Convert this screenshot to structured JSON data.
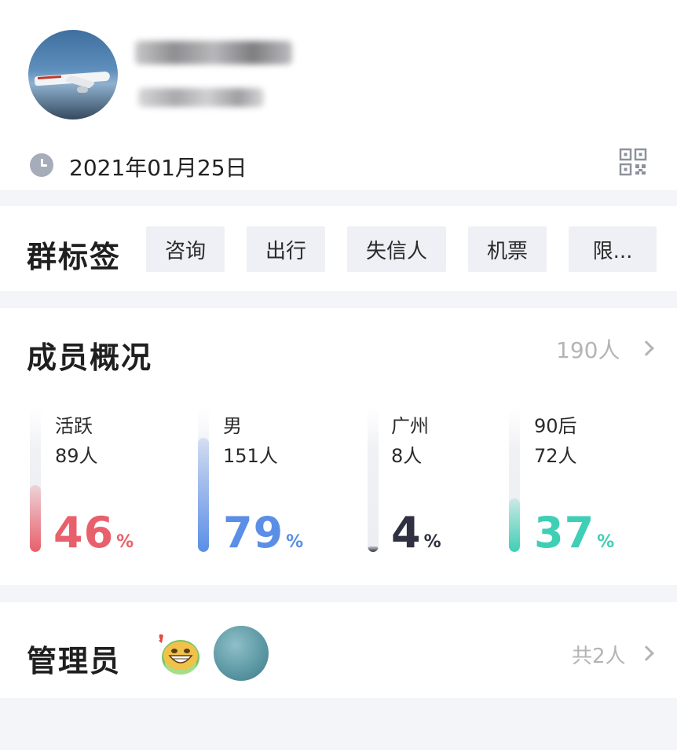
{
  "header": {
    "date": "2021年01月25日",
    "icons": {
      "clock": "clock-icon",
      "qr": "qr-code-icon"
    }
  },
  "tags": {
    "title": "群标签",
    "items": [
      "咨询",
      "出行",
      "失信人",
      "机票",
      "限..."
    ]
  },
  "members": {
    "title": "成员概况",
    "count": "190人",
    "stats": [
      {
        "label": "活跃",
        "count": "89人",
        "percent": 46,
        "unit": "%",
        "color": "#e8606b"
      },
      {
        "label": "男",
        "count": "151人",
        "percent": 79,
        "unit": "%",
        "color": "#5b8ee6"
      },
      {
        "label": "广州",
        "count": "8人",
        "percent": 4,
        "unit": "%",
        "color": "#2f3142"
      },
      {
        "label": "90后",
        "count": "72人",
        "percent": 37,
        "unit": "%",
        "color": "#3fcfb5"
      }
    ]
  },
  "admins": {
    "title": "管理员",
    "count": "共2人"
  },
  "colors": {
    "background": "#f4f5f8",
    "tag_background": "#eff0f5",
    "muted_text": "#b4b4b8"
  }
}
